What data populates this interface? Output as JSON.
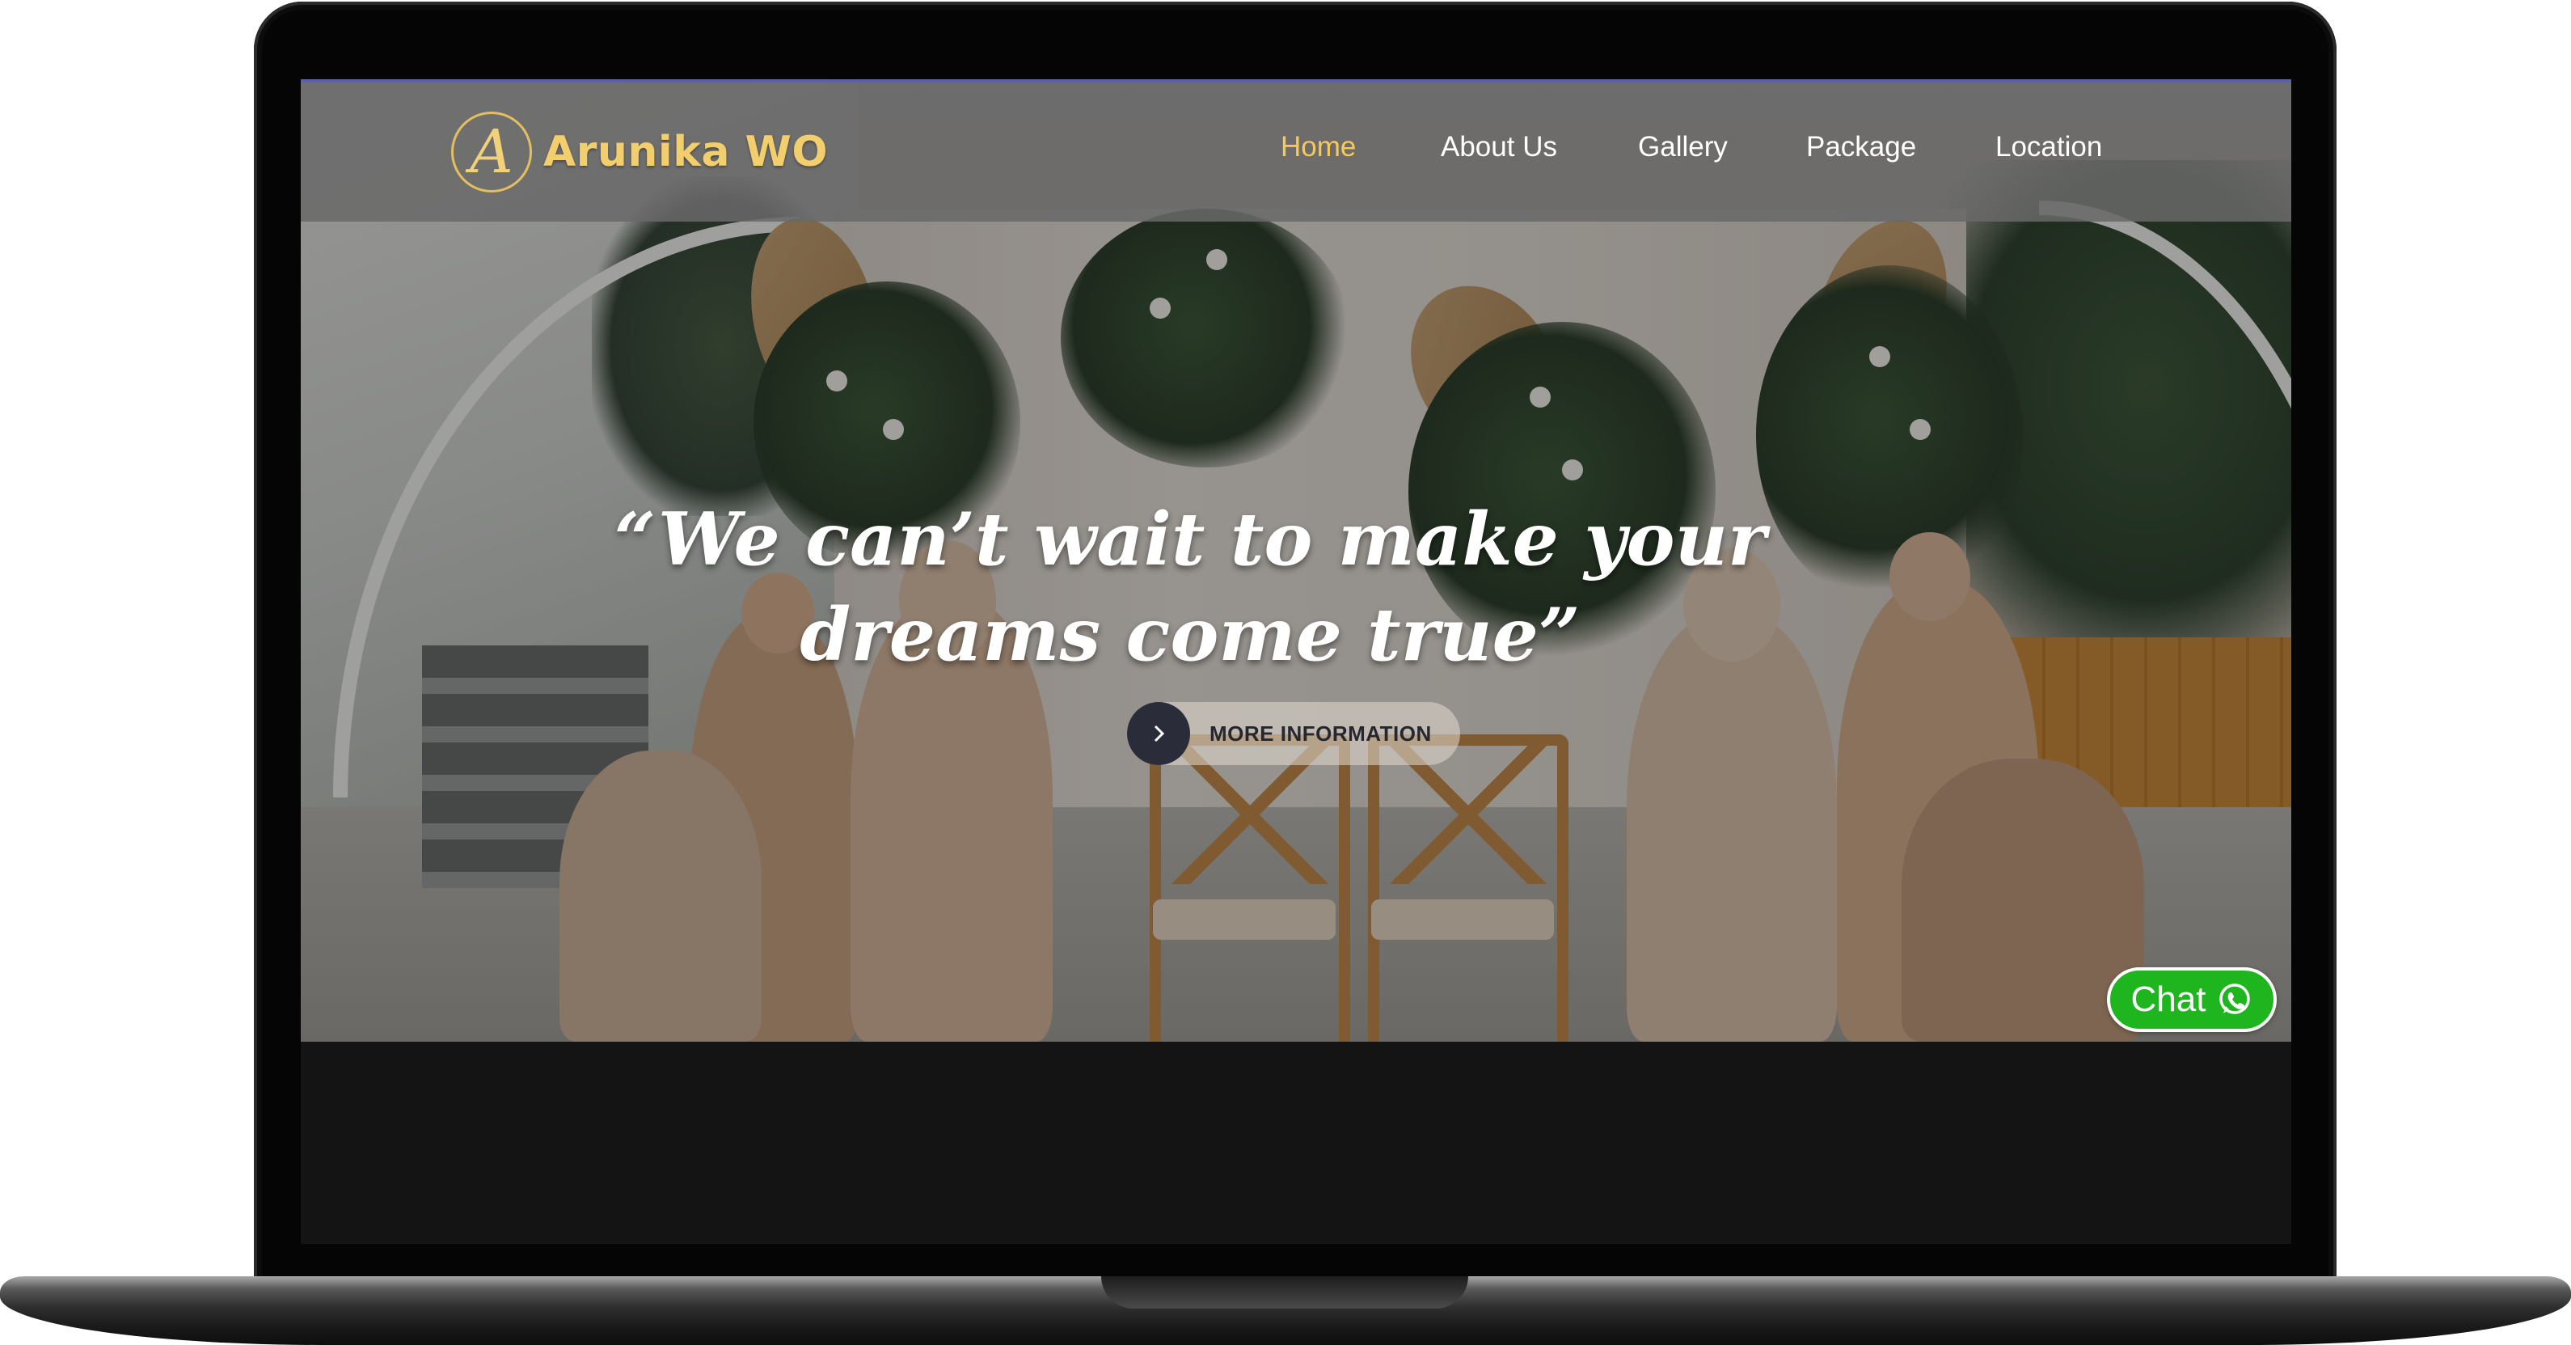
{
  "brand": {
    "logo_letter": "A",
    "name": "Arunika WO",
    "accent_color": "#f2cf6c"
  },
  "nav": {
    "items": [
      {
        "label": "Home",
        "active": true
      },
      {
        "label": "About Us",
        "active": false
      },
      {
        "label": "Gallery",
        "active": false
      },
      {
        "label": "Package",
        "active": false
      },
      {
        "label": "Location",
        "active": false
      }
    ],
    "active_color": "#f6c95b"
  },
  "hero": {
    "headline_line1": "“We can’t wait to make your",
    "headline_line2": "dreams come true”",
    "cta_label": "MORE INFORMATION",
    "cta_icon": "chevron-right-icon"
  },
  "chat_widget": {
    "label": "Chat",
    "icon": "whatsapp-icon",
    "color": "#1fb51f"
  }
}
